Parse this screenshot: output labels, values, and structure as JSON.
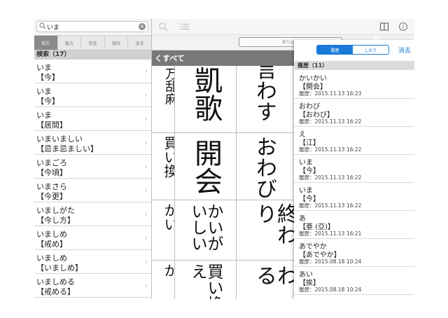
{
  "search": {
    "value": "いま",
    "placeholder": "",
    "clear_icon": "clear-icon"
  },
  "modes": [
    "前方",
    "後方",
    "完全",
    "部分",
    "全文"
  ],
  "results_header": "検索（17）",
  "results": [
    {
      "reading": "いま",
      "word": "【今】"
    },
    {
      "reading": "いま",
      "word": "【今】"
    },
    {
      "reading": "いま",
      "word": "【居間】"
    },
    {
      "reading": "いまいましい",
      "word": "【忌ま忌ましい】"
    },
    {
      "reading": "いまごろ",
      "word": "【今頃】"
    },
    {
      "reading": "いまさら",
      "word": "【今更】"
    },
    {
      "reading": "いましがた",
      "word": "【今し方】"
    },
    {
      "reading": "いましめ",
      "word": "【戒め】"
    },
    {
      "reading": "いましめ",
      "word": "【いましめ】"
    },
    {
      "reading": "いましめる",
      "word": "【戒める】"
    }
  ],
  "toolbar": {
    "filter_label": "絞り込み"
  },
  "back_label": "くすべて",
  "grid": {
    "col0": [
      "万乱麻",
      "買い換",
      "かい",
      "か"
    ],
    "col1": [
      "凱歌",
      "開会",
      "かいがいしい",
      "買い換え"
    ],
    "col2": [
      "言わす",
      "おわび",
      "終わり",
      "終わる"
    ]
  },
  "popover": {
    "tabs": [
      "履歴",
      "しおり"
    ],
    "active_tab": 0,
    "clear_label": "消去",
    "header": "履歴（11）",
    "items": [
      {
        "reading": "かいかい",
        "word": "【開会】",
        "date": "履歴：2015.11.13 16:23"
      },
      {
        "reading": "おわび",
        "word": "【おわび】",
        "date": "履歴：2015.11.13 16:22"
      },
      {
        "reading": "え",
        "word": "【江】",
        "date": "履歴：2015.11.13 16:22"
      },
      {
        "reading": "いま",
        "word": "【今】",
        "date": "履歴：2015.11.13 16:22"
      },
      {
        "reading": "いま",
        "word": "【今】",
        "date": "履歴：2015.11.13 16:22"
      },
      {
        "reading": "あ",
        "word": "【亜 (亞)】",
        "date": "履歴：2015.11.13 16:21"
      },
      {
        "reading": "あでやか",
        "word": "【あでやか】",
        "date": "履歴：2015.08.18 10:24"
      },
      {
        "reading": "あい",
        "word": "【挨】",
        "date": "履歴：2015.08.18 10:24"
      }
    ]
  },
  "icons": {
    "search": "search-icon",
    "list": "list-icon",
    "book": "book-icon",
    "info": "info-icon",
    "chevron": "chevron-right-icon"
  }
}
